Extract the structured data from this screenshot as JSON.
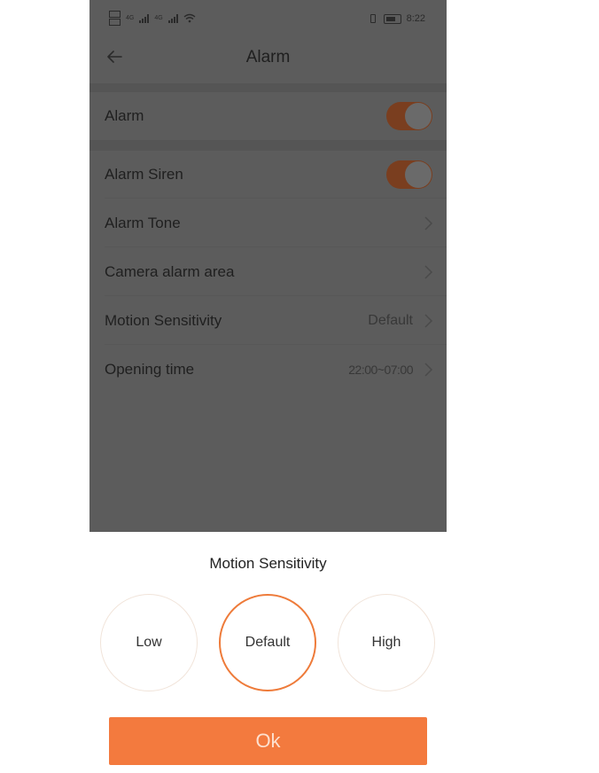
{
  "status_bar": {
    "network_left": "4G",
    "network_right": "4G",
    "time": "8:22"
  },
  "header": {
    "title": "Alarm",
    "back_icon": "arrow-left-icon"
  },
  "settings": {
    "alarm": {
      "label": "Alarm",
      "enabled": true
    },
    "alarm_siren": {
      "label": "Alarm Siren",
      "enabled": true
    },
    "alarm_tone": {
      "label": "Alarm Tone"
    },
    "camera_alarm_area": {
      "label": "Camera alarm area"
    },
    "motion_sensitivity": {
      "label": "Motion Sensitivity",
      "value": "Default"
    },
    "opening_time": {
      "label": "Opening time",
      "value": "22:00~07:00"
    }
  },
  "sheet": {
    "title": "Motion Sensitivity",
    "options": [
      {
        "label": "Low",
        "selected": false
      },
      {
        "label": "Default",
        "selected": true
      },
      {
        "label": "High",
        "selected": false
      }
    ],
    "ok_label": "Ok"
  },
  "colors": {
    "accent": "#f37a3e",
    "toggle_on_dimmed": "#7a3e1f",
    "overlay_bg": "#5c5c5c"
  }
}
